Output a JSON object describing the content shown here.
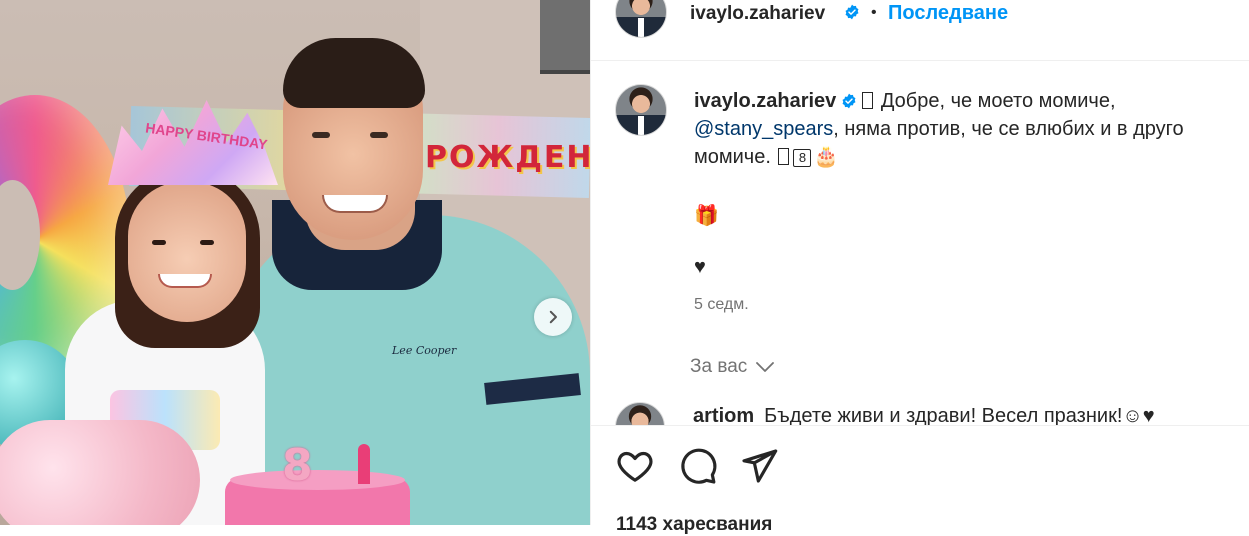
{
  "post": {
    "author": "ivaylo.zahariev",
    "separator": "•",
    "follow_label": "Последване"
  },
  "caption": {
    "author": "ivaylo.zahariev",
    "text_1": "Добре, че моето момиче,",
    "mention": "@stany_spears",
    "text_2": ", няма против, че се влюбих и в друго момиче.",
    "keycap": "8",
    "cake_emoji": "🎂",
    "gift_emoji": "🎁",
    "heart_emoji": "♥",
    "time": "5 седм."
  },
  "for_you": {
    "label": "За вас"
  },
  "comment": {
    "author": "artiom",
    "text": "Бъдете живи и здрави! Весел празник!",
    "emoji": "☺♥"
  },
  "photo": {
    "banner_text": "РОЖДЕН",
    "tiara_text": "HAPPY BIRTHDAY",
    "candle": "8",
    "shirt_logo": "Lee Cooper"
  },
  "likes": {
    "label": "1143 харесвания"
  },
  "colors": {
    "accent": "#0095f6",
    "verified": "#0095f6",
    "text": "#262626",
    "muted": "#737373",
    "mention": "#00376b"
  }
}
